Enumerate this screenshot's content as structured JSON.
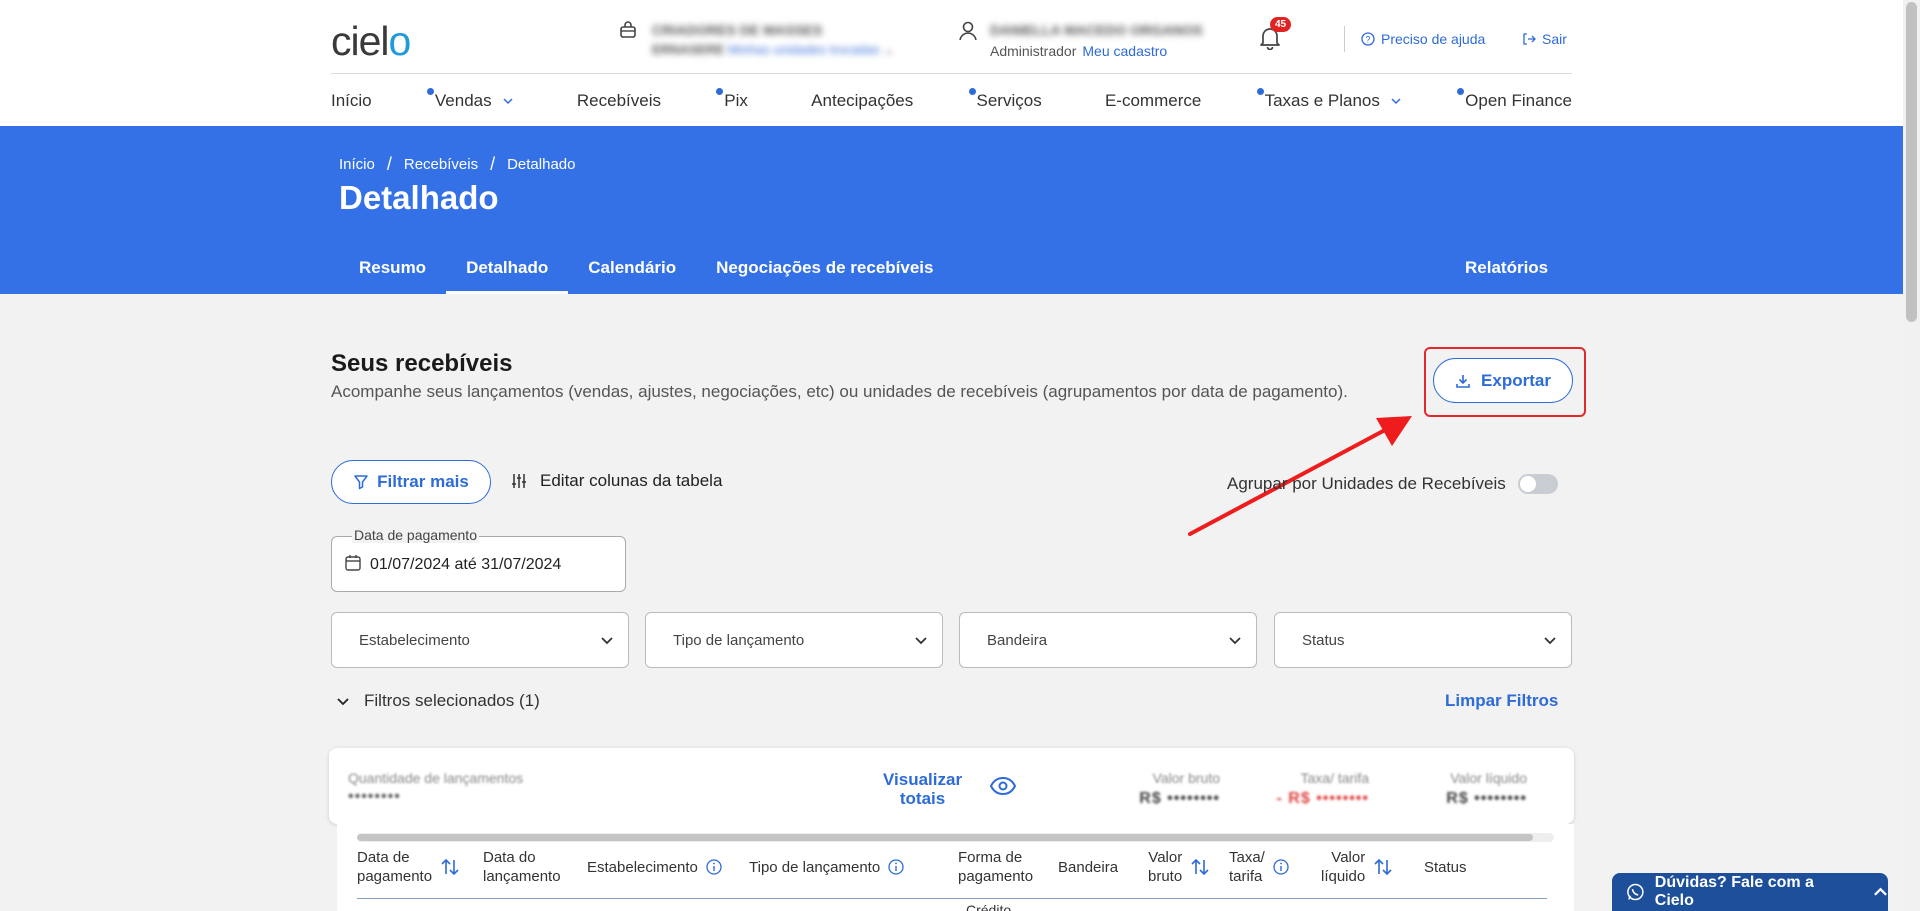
{
  "header": {
    "logo_text": "cielo",
    "merchant_line1": "CRIADORES DE MASSES",
    "merchant_line2_prefix": "ERNASERE",
    "merchant_line2_link": "Minhas unidades trocadas",
    "user_name": "DANIELLA MACEDO ORGANOS",
    "user_role": "Administrador",
    "user_link": "Meu cadastro",
    "notif_count": "45",
    "help": "Preciso de ajuda",
    "logout": "Sair"
  },
  "nav": [
    {
      "label": "Início",
      "dot": false,
      "chev": false
    },
    {
      "label": "Vendas",
      "dot": true,
      "chev": true
    },
    {
      "label": "Recebíveis",
      "dot": false,
      "chev": false
    },
    {
      "label": "Pix",
      "dot": true,
      "chev": false
    },
    {
      "label": "Antecipações",
      "dot": false,
      "chev": false
    },
    {
      "label": "Serviços",
      "dot": true,
      "chev": false
    },
    {
      "label": "E-commerce",
      "dot": false,
      "chev": false
    },
    {
      "label": "Taxas e Planos",
      "dot": true,
      "chev": true
    },
    {
      "label": "Open Finance",
      "dot": true,
      "chev": false
    }
  ],
  "hero": {
    "crumbs": [
      "Início",
      "Recebíveis",
      "Detalhado"
    ],
    "title": "Detalhado",
    "tabs": [
      "Resumo",
      "Detalhado",
      "Calendário",
      "Negociações de recebíveis"
    ],
    "active_tab": 1,
    "reports": "Relatórios"
  },
  "section": {
    "title": "Seus recebíveis",
    "subtitle": "Acompanhe seus lançamentos (vendas, ajustes, negociações, etc) ou unidades de recebíveis (agrupamentos por data de pagamento).",
    "export": "Exportar"
  },
  "filters": {
    "filter_more": "Filtrar mais",
    "edit_columns": "Editar colunas da tabela",
    "group_toggle": "Agrupar por Unidades de Recebíveis",
    "date_label": "Data de pagamento",
    "date_value": "01/07/2024 até 31/07/2024",
    "selects": [
      "Estabelecimento",
      "Tipo de lançamento",
      "Bandeira",
      "Status"
    ],
    "selected": "Filtros selecionados (1)",
    "clear": "Limpar Filtros"
  },
  "totals": {
    "qty_label": "Quantidade de lançamentos",
    "qty_value": "••••••••",
    "view_line1": "Visualizar",
    "view_line2": "totais",
    "gross_label": "Valor bruto",
    "gross_value": "R$ ••••••••",
    "fee_label": "Taxa/ tarifa",
    "fee_value": "- R$ ••••••••",
    "net_label": "Valor líquido",
    "net_value": "R$ ••••••••"
  },
  "table": {
    "headers": [
      {
        "l1": "Data de",
        "l2": "pagamento",
        "sort": true,
        "info": false
      },
      {
        "l1": "Data do",
        "l2": "lançamento",
        "sort": false,
        "info": false
      },
      {
        "l1": "Estabelecimento",
        "l2": "",
        "sort": false,
        "info": true
      },
      {
        "l1": "Tipo de lançamento",
        "l2": "",
        "sort": false,
        "info": true
      },
      {
        "l1": "Forma de",
        "l2": "pagamento",
        "sort": false,
        "info": false
      },
      {
        "l1": "Bandeira",
        "l2": "",
        "sort": false,
        "info": false
      },
      {
        "l1": "Valor",
        "l2": "bruto",
        "sort": true,
        "info": false
      },
      {
        "l1": "Taxa/",
        "l2": "tarifa",
        "sort": false,
        "info": true
      },
      {
        "l1": "Valor",
        "l2": "líquido",
        "sort": true,
        "info": false
      },
      {
        "l1": "Status",
        "l2": "",
        "sort": false,
        "info": false
      }
    ],
    "first_row_peek": "Crédito"
  },
  "chat": {
    "label": "Dúvidas? Fale com a Cielo"
  },
  "colors": {
    "brand_blue": "#3471e6",
    "link_blue": "#2d6bd8",
    "alert_red": "#e5282b"
  }
}
